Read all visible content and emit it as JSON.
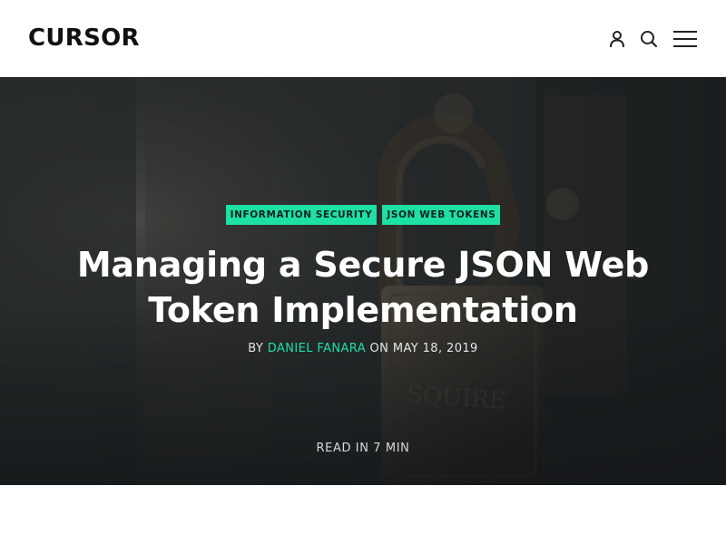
{
  "header": {
    "logo": "CURSOR",
    "icons": [
      "user-icon",
      "search-icon",
      "menu-icon"
    ]
  },
  "hero": {
    "tags": [
      "INFORMATION SECURITY",
      "JSON WEB TOKENS"
    ],
    "title": "Managing a Secure JSON Web Token Implementation",
    "byline": {
      "prefix": "BY",
      "author": "DANIEL FANARA",
      "connector": "ON",
      "date": "MAY 18, 2019"
    },
    "read_time": "READ IN 7 MIN"
  },
  "colors": {
    "accent": "#1ce0a4",
    "header_bg": "#ffffff",
    "logo": "#111111",
    "hero_text": "#ffffff"
  }
}
